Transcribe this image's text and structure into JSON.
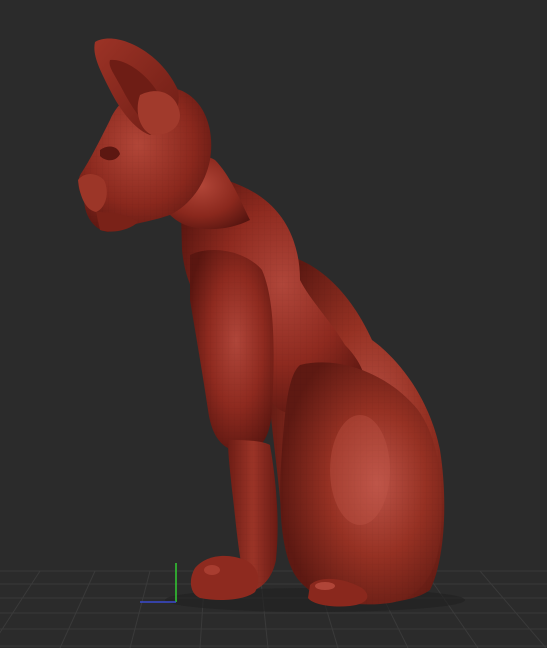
{
  "app": {
    "view": "3d-viewport"
  },
  "scene": {
    "background_color": "#2b2b2b",
    "floor_grid": true,
    "grid_color": "#3a3a3a",
    "model": {
      "subject": "sitting-cat-sculpt",
      "material_color": "#8e2a1f",
      "highlight_color": "#b4473a",
      "shadow_color": "#5a1610",
      "wireframe_overlay": true
    },
    "axis_gizmo": {
      "x_color": "#3b4bd0",
      "y_color": "#33cc33"
    }
  }
}
